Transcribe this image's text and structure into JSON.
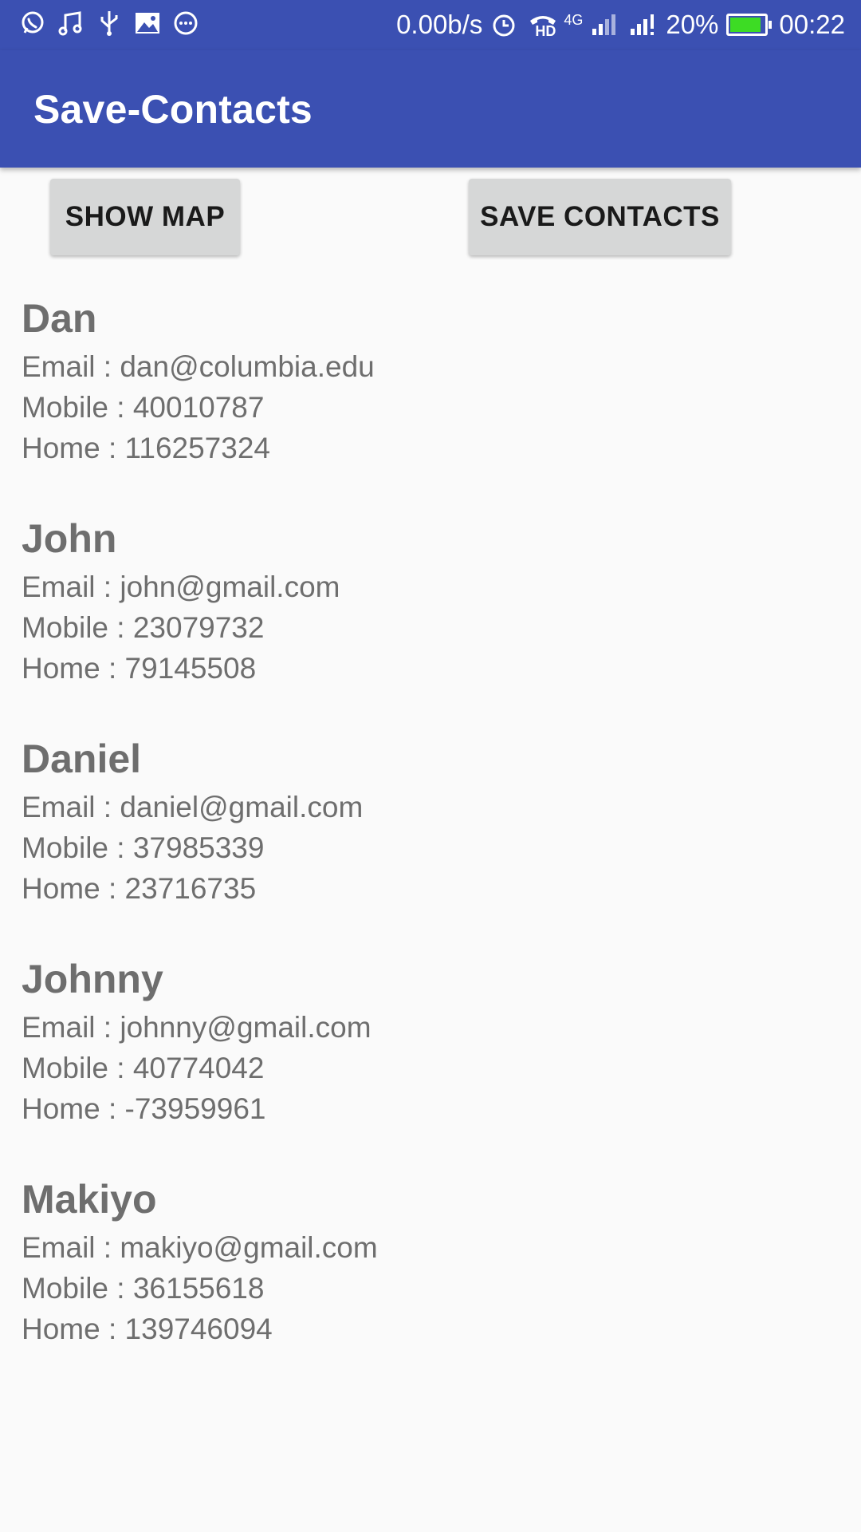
{
  "status_bar": {
    "icons_left": [
      "whatsapp-icon",
      "music-icon",
      "usb-icon",
      "image-icon",
      "more-icon"
    ],
    "network_speed": "0.00b/s",
    "network_label": "4G",
    "hd_label": "HD",
    "battery_percent": "20%",
    "battery_level": 0.2,
    "time": "00:22"
  },
  "app_bar": {
    "title": "Save-Contacts"
  },
  "buttons": {
    "show_map": "SHOW MAP",
    "save_contacts": "SAVE CONTACTS"
  },
  "contacts": [
    {
      "name": "Dan",
      "email": "Email : dan@columbia.edu",
      "mobile": "Mobile : 40010787",
      "home": "Home : 116257324"
    },
    {
      "name": "John",
      "email": "Email : john@gmail.com",
      "mobile": "Mobile : 23079732",
      "home": "Home : 79145508"
    },
    {
      "name": "Daniel",
      "email": "Email : daniel@gmail.com",
      "mobile": "Mobile : 37985339",
      "home": "Home : 23716735"
    },
    {
      "name": "Johnny",
      "email": "Email : johnny@gmail.com",
      "mobile": "Mobile : 40774042",
      "home": "Home : -73959961"
    },
    {
      "name": "Makiyo",
      "email": "Email : makiyo@gmail.com",
      "mobile": "Mobile : 36155618",
      "home": "Home : 139746094"
    }
  ],
  "colors": {
    "primary": "#3b50b2",
    "background": "#fafafa",
    "button": "#d6d7d7",
    "text": "#6e6e6e",
    "battery": "#3ddc24"
  }
}
